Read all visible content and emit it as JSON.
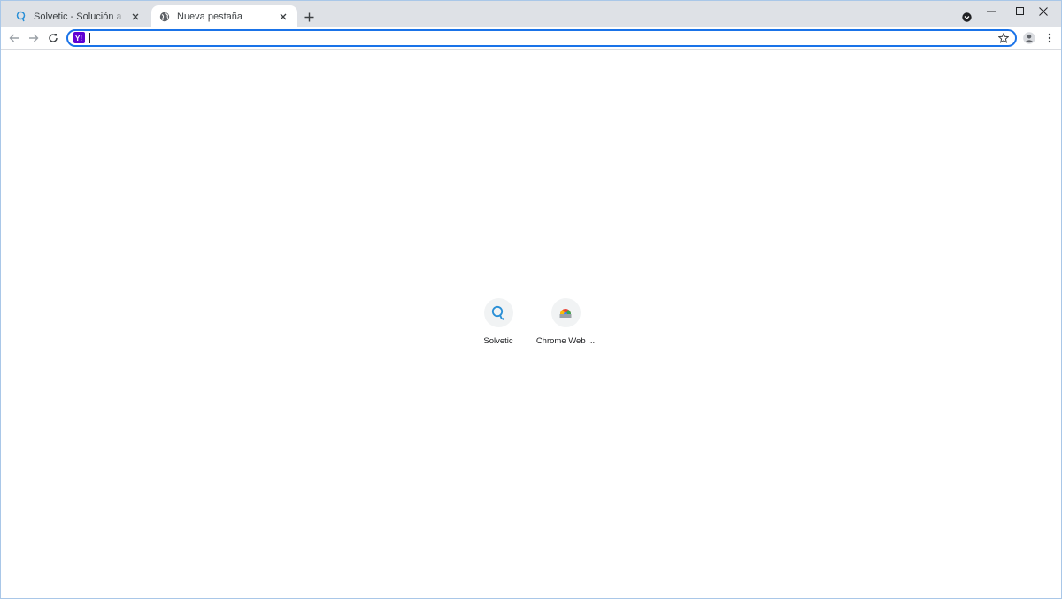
{
  "tabs": [
    {
      "title": "Solvetic - Solución a los problemas",
      "favicon": "solvetic-icon",
      "active": false
    },
    {
      "title": "Nueva pestaña",
      "favicon": "globe-icon",
      "active": true
    }
  ],
  "toolbar": {
    "omnibox_value": "",
    "search_engine_icon": "yahoo-icon",
    "search_engine_color": "#6001d2"
  },
  "shortcuts": [
    {
      "label": "Solvetic",
      "icon": "solvetic-icon"
    },
    {
      "label": "Chrome Web ...",
      "icon": "chrome-web-store-icon"
    }
  ],
  "colors": {
    "tabstrip": "#dee1e6",
    "accent": "#1a73e8"
  }
}
